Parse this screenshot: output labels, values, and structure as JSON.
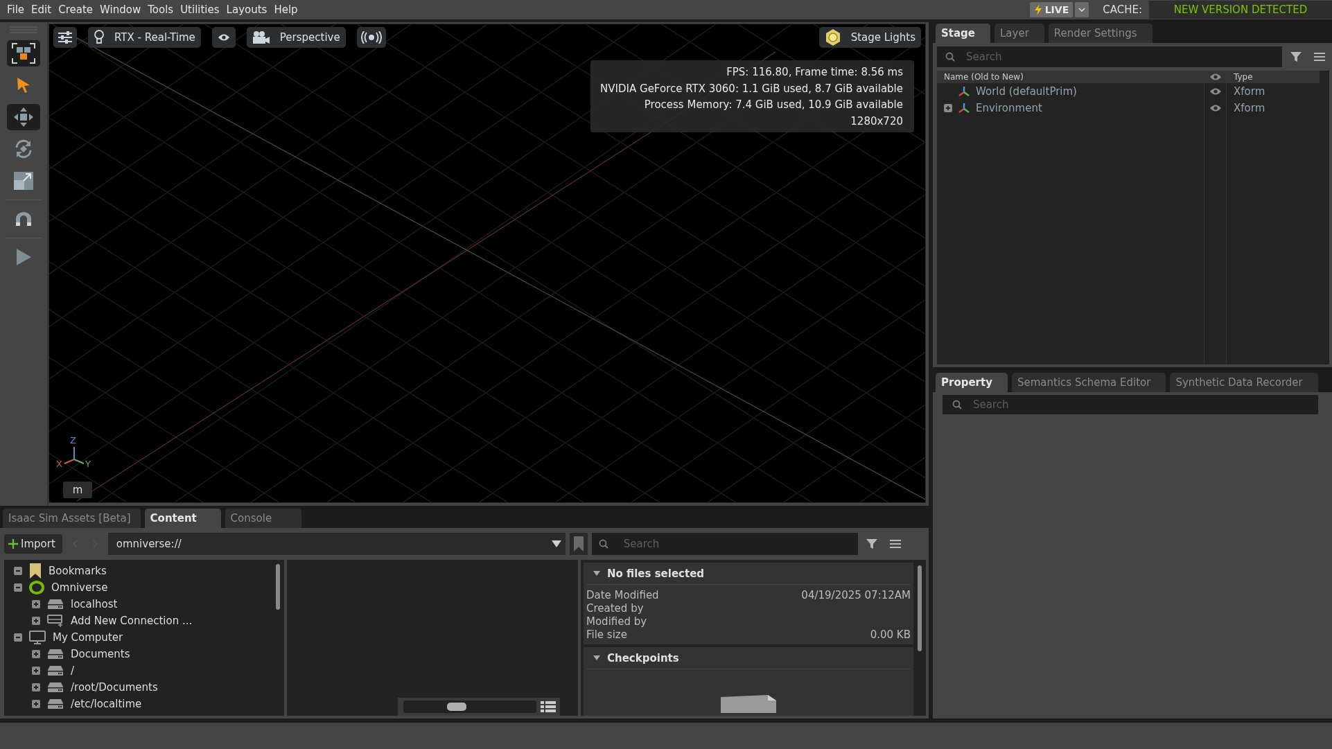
{
  "menu_bar": {
    "items": [
      "File",
      "Edit",
      "Create",
      "Window",
      "Tools",
      "Utilities",
      "Layouts",
      "Help"
    ],
    "live_button": {
      "label": "LIVE"
    },
    "cache_label": "CACHE:",
    "cache_status": "NEW VERSION DETECTED"
  },
  "tool_bar": {
    "tools": [
      {
        "kind": "frame",
        "highlighted": true
      },
      {
        "kind": "select",
        "highlighted": false
      },
      {
        "kind": "move",
        "highlighted": true
      },
      {
        "kind": "rotate",
        "highlighted": false
      },
      {
        "kind": "scale",
        "highlighted": false
      },
      {
        "kind": "snap",
        "highlighted": false
      },
      {
        "kind": "play",
        "highlighted": false
      }
    ]
  },
  "viewport": {
    "renderer": "RTX - Real-Time",
    "camera": "Perspective",
    "lights": "Stage Lights",
    "stats": [
      "FPS: 116.80, Frame time: 8.56 ms",
      "NVIDIA GeForce RTX 3060: 1.1 GiB used, 8.7 GiB available",
      "Process Memory: 7.4 GiB used, 10.9 GiB available",
      "1280x720"
    ],
    "axes": {
      "z": "Z",
      "x": "X",
      "y": "Y"
    },
    "units": "m"
  },
  "stage": {
    "tabs": [
      {
        "label": "Stage",
        "selected": true
      },
      {
        "label": "Layer",
        "selected": false
      },
      {
        "label": "Render Settings",
        "selected": false
      }
    ],
    "search": {
      "placeholder": "Search"
    },
    "columns": [
      "Name (Old to New)",
      "Type"
    ],
    "rows": [
      {
        "name": "World (defaultPrim)",
        "type": "Xform",
        "has_children": false,
        "visible": true
      },
      {
        "name": "Environment",
        "type": "Xform",
        "has_children": true,
        "visible": true
      }
    ]
  },
  "property": {
    "tabs": [
      {
        "label": "Property",
        "selected": true
      },
      {
        "label": "Semantics Schema Editor",
        "selected": false
      },
      {
        "label": "Synthetic Data Recorder",
        "selected": false
      }
    ],
    "search": {
      "placeholder": "Search"
    }
  },
  "content": {
    "tabs": [
      {
        "label": "Isaac Sim Assets [Beta]",
        "selected": false
      },
      {
        "label": "Content",
        "selected": true
      },
      {
        "label": "Console",
        "selected": false
      }
    ],
    "import_button": "Import",
    "path": "omniverse://",
    "search": {
      "placeholder": "Search"
    },
    "tree": [
      {
        "label": "Bookmarks",
        "kind": "bookmark",
        "expanded": true
      },
      {
        "label": "Omniverse",
        "kind": "omniverse",
        "expanded": true,
        "children": [
          {
            "label": "localhost",
            "kind": "server",
            "expanded": false
          },
          {
            "label": "Add New Connection ...",
            "kind": "add-server",
            "expanded": false
          }
        ]
      },
      {
        "label": "My Computer",
        "kind": "computer",
        "expanded": true,
        "children": [
          {
            "label": "Documents",
            "kind": "server",
            "expanded": false
          },
          {
            "label": "/",
            "kind": "server",
            "expanded": false
          },
          {
            "label": "/root/Documents",
            "kind": "server",
            "expanded": false
          },
          {
            "label": "/etc/localtime",
            "kind": "server",
            "expanded": false
          }
        ]
      }
    ],
    "thumbnail_size": {
      "level": 0.4
    },
    "details": {
      "title": "No files selected",
      "expanded": true,
      "fields": [
        {
          "label": "Date Modified",
          "value": "04/19/2025 07:12AM"
        },
        {
          "label": "Created by"
        },
        {
          "label": "Modified by"
        },
        {
          "label": "File size",
          "value": "0.00 KB"
        }
      ]
    },
    "checkpoints": {
      "title": "Checkpoints",
      "expanded": true
    }
  }
}
